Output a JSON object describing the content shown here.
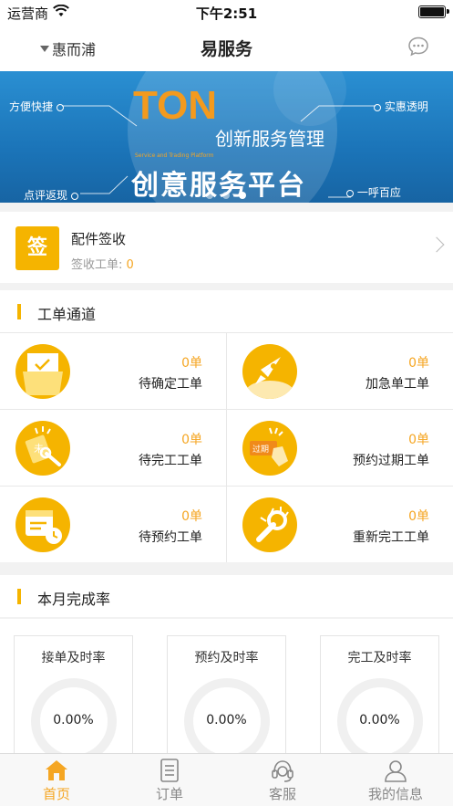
{
  "status_bar": {
    "carrier": "运营商",
    "time": "下午2:51"
  },
  "nav": {
    "location": "惠而浦",
    "title": "易服务"
  },
  "banner": {
    "tags": [
      "方便快捷",
      "实惠透明",
      "点评返现",
      "一呼百应"
    ],
    "brand_text": "创新服务管理",
    "brand_small": "Service and Trading Platform",
    "slogan": "创意服务平台",
    "page_count": 3,
    "active_page": 3
  },
  "sign_card": {
    "badge": "签",
    "title": "配件签收",
    "subtitle_label": "签收工单:",
    "subtitle_value": "0"
  },
  "work_channel": {
    "title": "工单通道",
    "items": [
      {
        "name": "待确定工单",
        "count": "0单",
        "icon": "folder-check-icon"
      },
      {
        "name": "加急单工单",
        "count": "0单",
        "icon": "rocket-icon"
      },
      {
        "name": "待完工工单",
        "count": "0单",
        "icon": "wrench-tag-icon"
      },
      {
        "name": "预约过期工单",
        "count": "0单",
        "icon": "expired-tag-icon"
      },
      {
        "name": "待预约工单",
        "count": "0单",
        "icon": "calendar-clock-icon"
      },
      {
        "name": "重新完工工单",
        "count": "0单",
        "icon": "repair-icon"
      }
    ]
  },
  "monthly": {
    "title": "本月完成率",
    "rates": [
      {
        "label": "接单及时率",
        "value": "0.00%"
      },
      {
        "label": "预约及时率",
        "value": "0.00%"
      },
      {
        "label": "完工及时率",
        "value": "0.00%"
      }
    ]
  },
  "tabs": [
    {
      "label": "首页",
      "icon": "home-icon",
      "active": true
    },
    {
      "label": "订单",
      "icon": "document-icon",
      "active": false
    },
    {
      "label": "客服",
      "icon": "headset-icon",
      "active": false
    },
    {
      "label": "我的信息",
      "icon": "user-icon",
      "active": false
    }
  ],
  "colors": {
    "accent": "#f5b400",
    "accent_text": "#f5a623",
    "banner_blue": "#1b74b8"
  }
}
